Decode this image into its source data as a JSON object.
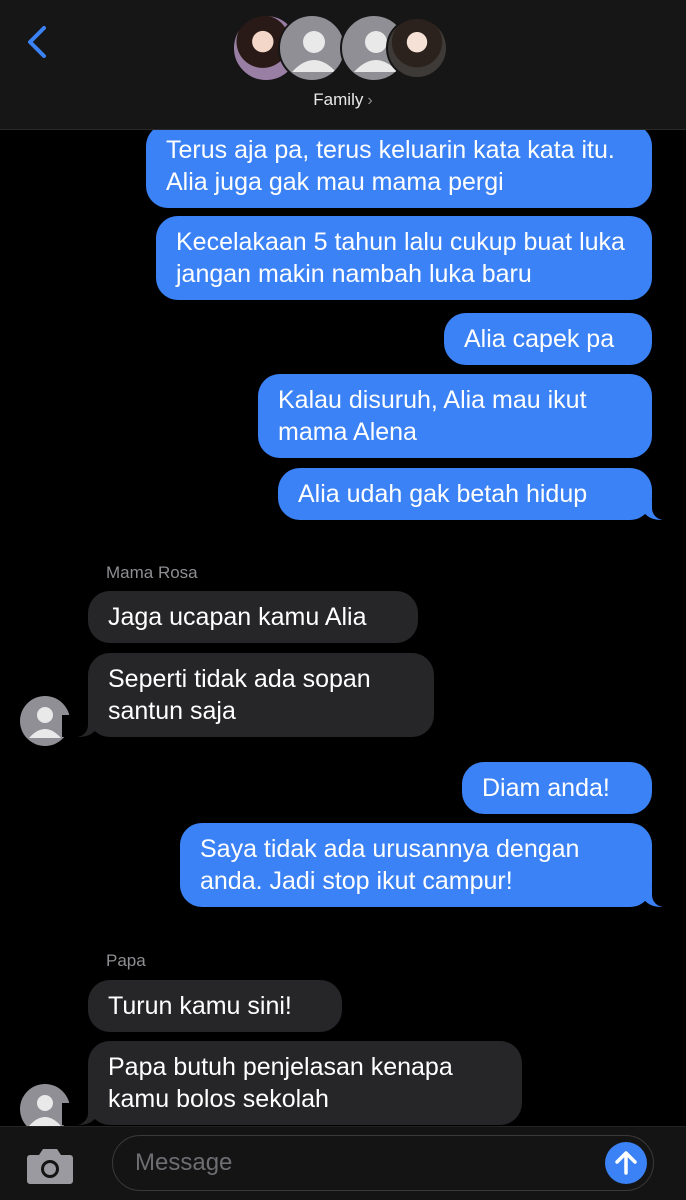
{
  "header": {
    "back_icon": "chevron-left-icon",
    "group_name": "Family",
    "chevron": "›"
  },
  "messages": [
    {
      "type": "outgoing",
      "text": "Terus aja pa, terus keluarin kata kata itu. Alia juga gak mau mama pergi"
    },
    {
      "type": "outgoing",
      "text": "Kecelakaan 5 tahun lalu cukup buat luka jangan makin nambah luka baru"
    },
    {
      "type": "outgoing",
      "text": "Alia capek pa"
    },
    {
      "type": "outgoing",
      "text": "Kalau disuruh, Alia mau ikut mama Alena"
    },
    {
      "type": "outgoing",
      "text": "Alia udah gak betah hidup"
    },
    {
      "type": "sender",
      "text": "Mama Rosa"
    },
    {
      "type": "incoming",
      "text": "Jaga ucapan kamu Alia"
    },
    {
      "type": "incoming",
      "text": "Seperti tidak ada sopan santun saja"
    },
    {
      "type": "outgoing",
      "text": "Diam anda!"
    },
    {
      "type": "outgoing",
      "text": "Saya tidak ada urusannya dengan anda. Jadi stop ikut campur!"
    },
    {
      "type": "sender",
      "text": "Papa"
    },
    {
      "type": "incoming",
      "text": "Turun kamu sini!"
    },
    {
      "type": "incoming",
      "text": "Papa butuh penjelasan kenapa kamu bolos sekolah"
    }
  ],
  "input": {
    "placeholder": "Message",
    "camera_icon": "camera-icon",
    "send_icon": "arrow-up-icon"
  },
  "colors": {
    "outgoing_bubble": "#3b82f6",
    "incoming_bubble": "#262628",
    "background": "#000000"
  }
}
